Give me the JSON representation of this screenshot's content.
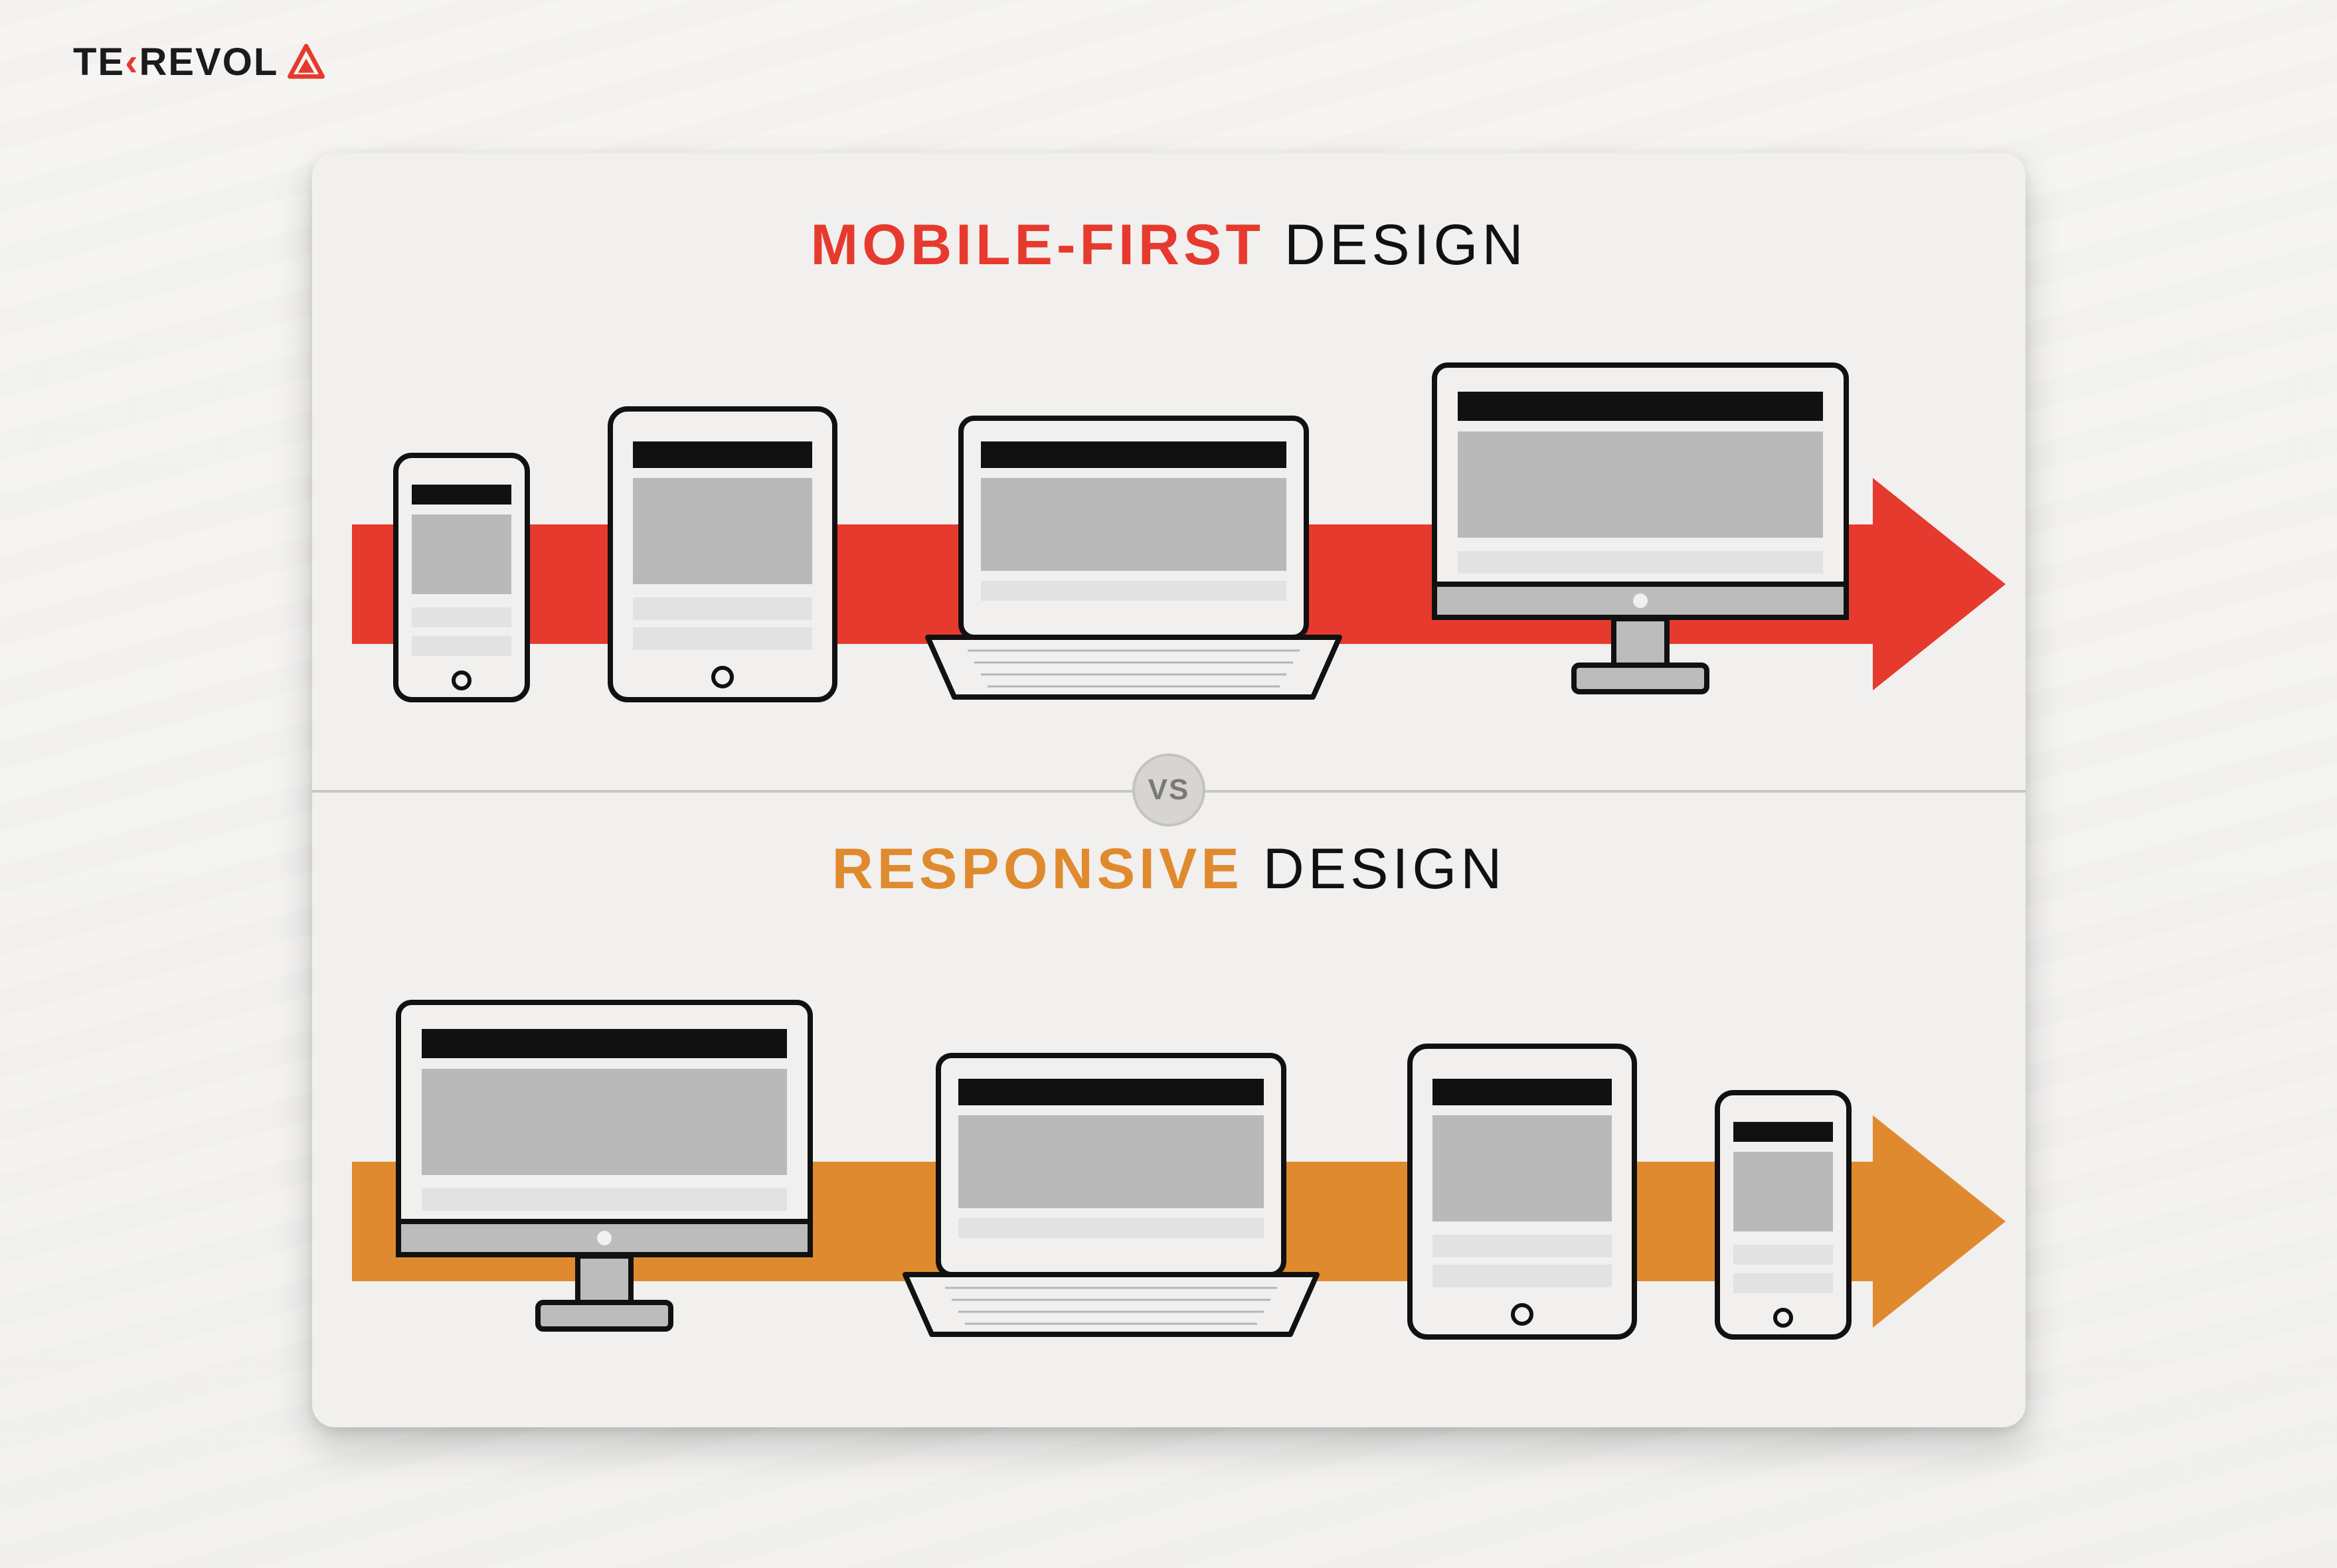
{
  "logo": {
    "text_pre": "TE",
    "text_post": "REVOL",
    "chevron": "‹"
  },
  "colors": {
    "red": "#e63a2e",
    "orange": "#e08a2f",
    "dark": "#111111",
    "card_bg": "#f1f0ee"
  },
  "vs_label": "VS",
  "rows": [
    {
      "id": "mobile-first",
      "title_accent": "MOBILE-FIRST",
      "title_rest": " DESIGN",
      "accent_class": "accent-red",
      "arrow_color": "red",
      "devices": [
        "phone",
        "tablet",
        "laptop",
        "desktop"
      ]
    },
    {
      "id": "responsive",
      "title_accent": "RESPONSIVE",
      "title_rest": "  DESIGN",
      "accent_class": "accent-orange",
      "arrow_color": "orange",
      "devices": [
        "desktop",
        "laptop",
        "tablet",
        "phone"
      ]
    }
  ],
  "device_labels": {
    "phone": "phone-icon",
    "tablet": "tablet-icon",
    "laptop": "laptop-icon",
    "desktop": "desktop-icon"
  }
}
